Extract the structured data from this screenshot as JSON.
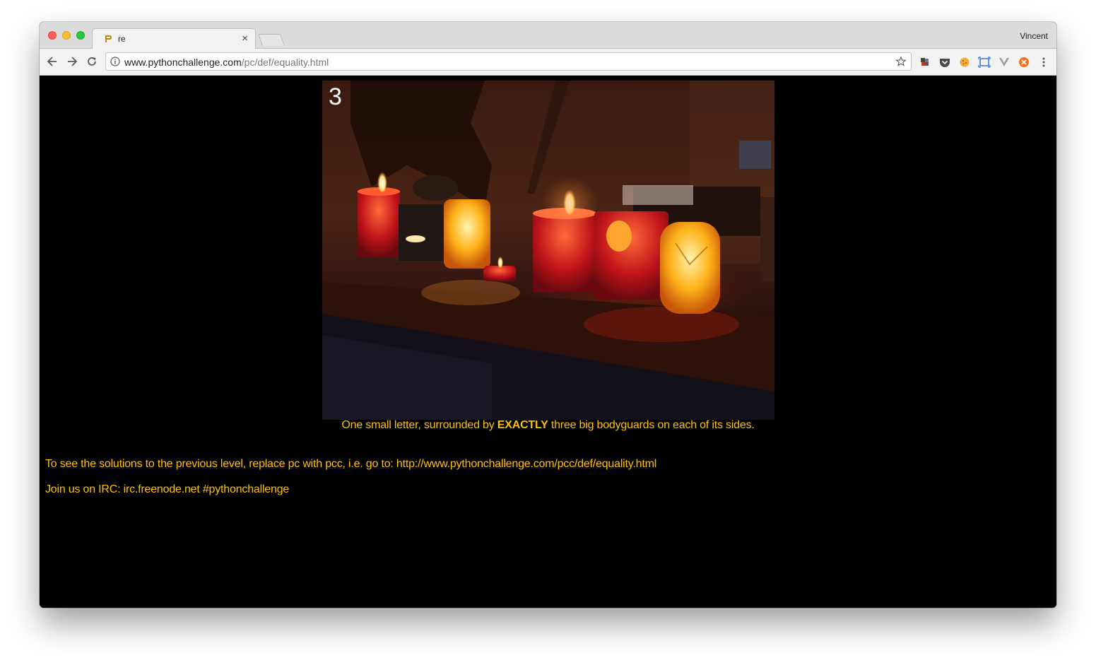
{
  "browser": {
    "tab_title": "re",
    "tab_close_label": "×",
    "profile_name": "Vincent",
    "url_host": "www.pythonchallenge.com",
    "url_path": "/pc/def/equality.html",
    "toolbar_icons": [
      "back-arrow-icon",
      "forward-arrow-icon",
      "reload-icon",
      "info-icon",
      "bookmark-star-icon"
    ],
    "extension_icons": [
      "puzzle-extension-icon",
      "pocket-icon",
      "cookie-icon",
      "screen-capture-icon",
      "vue-devtools-icon",
      "orange-extension-icon",
      "menu-dots-icon"
    ]
  },
  "content": {
    "image_overlay_number": "3",
    "caption_before": "One small letter, surrounded by ",
    "caption_bold": "EXACTLY",
    "caption_after": " three big bodyguards on each of its sides.",
    "solutions_text": "To see the solutions to the previous level, replace pc with pcc, i.e. go to: http://www.pythonchallenge.com/pcc/def/equality.html",
    "irc_text": "Join us on IRC: irc.freenode.net #pythonchallenge"
  },
  "colors": {
    "page_background": "#000000",
    "text_accent": "#ffc000"
  }
}
